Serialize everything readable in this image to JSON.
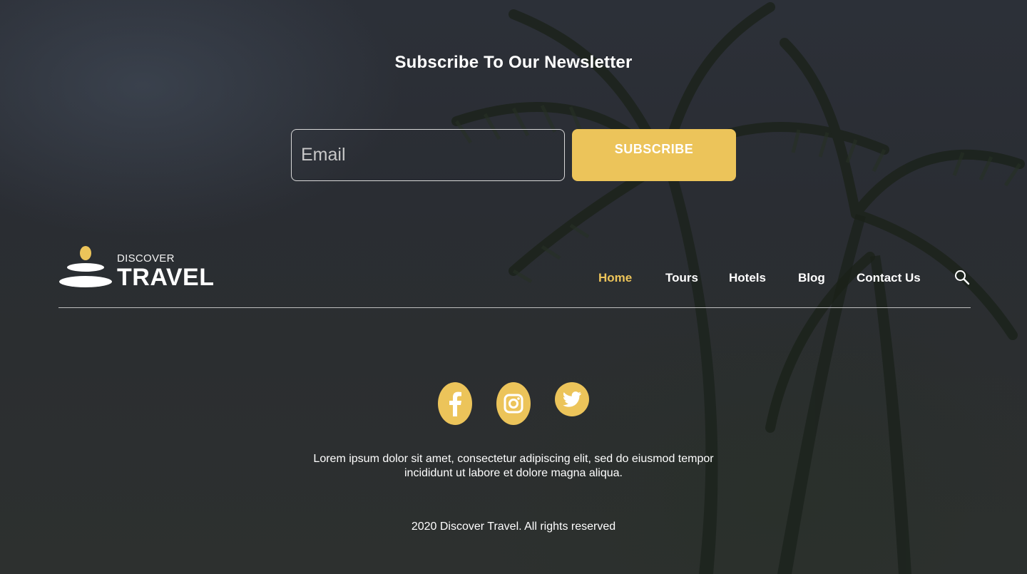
{
  "newsletter": {
    "title": "Subscribe To Our Newsletter",
    "email_placeholder": "Email",
    "email_value": "",
    "subscribe_label": "SUBSCRIBE"
  },
  "brand": {
    "small": "DISCOVER",
    "big": "TRAVEL"
  },
  "nav": {
    "items": [
      {
        "label": "Home",
        "active": true
      },
      {
        "label": "Tours",
        "active": false
      },
      {
        "label": "Hotels",
        "active": false
      },
      {
        "label": "Blog",
        "active": false
      },
      {
        "label": "Contact Us",
        "active": false
      }
    ],
    "search_icon": "search-icon"
  },
  "social": [
    {
      "icon": "facebook-icon"
    },
    {
      "icon": "instagram-icon"
    },
    {
      "icon": "twitter-icon"
    }
  ],
  "footer": {
    "description_line1": "Lorem ipsum dolor sit amet, consectetur adipiscing elit, sed do eiusmod tempor",
    "description_line2": "incididunt ut labore et dolore magna aliqua.",
    "copyright": "2020 Discover Travel. All rights reserved"
  },
  "colors": {
    "accent": "#ecc45a",
    "background": "#2b2e32",
    "text": "#ffffff"
  }
}
